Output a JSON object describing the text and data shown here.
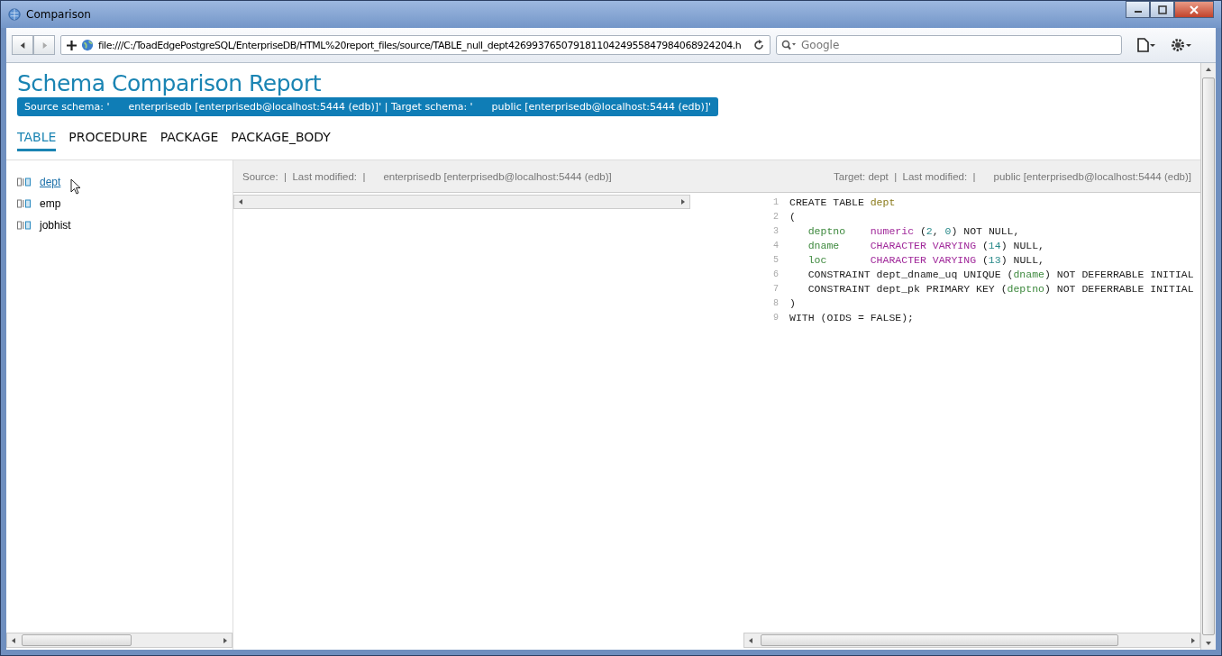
{
  "window": {
    "title": "Comparison"
  },
  "toolbar": {
    "url": "file:///C:/ToadEdgePostgreSQL/EnterpriseDB/HTML%20report_files/source/TABLE_null_dept42699376507918110424955847984068924204.h",
    "search_placeholder": "Google"
  },
  "report": {
    "title": "Schema Comparison Report",
    "banner": "Source schema: '      enterprisedb [enterprisedb@localhost:5444 (edb)]' | Target schema: '      public [enterprisedb@localhost:5444 (edb)]'"
  },
  "tabs": [
    {
      "label": "TABLE",
      "selected": true
    },
    {
      "label": "PROCEDURE",
      "selected": false
    },
    {
      "label": "PACKAGE",
      "selected": false
    },
    {
      "label": "PACKAGE_BODY",
      "selected": false
    }
  ],
  "objects": [
    {
      "name": "dept",
      "selected": true
    },
    {
      "name": "emp",
      "selected": false
    },
    {
      "name": "jobhist",
      "selected": false
    }
  ],
  "source_header": {
    "label": "Source:  |  Last modified:  |",
    "schema": "enterprisedb [enterprisedb@localhost:5444 (edb)]"
  },
  "target_header": {
    "label": "Target: dept  |  Last modified:  |",
    "schema": "public [enterprisedb@localhost:5444 (edb)]"
  },
  "target_code": [
    {
      "number": "1",
      "tokens": [
        {
          "text": "CREATE TABLE ",
          "kind": "plain"
        },
        {
          "text": "dept",
          "kind": "table"
        }
      ]
    },
    {
      "number": "2",
      "tokens": [
        {
          "text": "(",
          "kind": "plain"
        }
      ]
    },
    {
      "number": "3",
      "tokens": [
        {
          "text": "   deptno    ",
          "kind": "column"
        },
        {
          "text": "numeric",
          "kind": "type"
        },
        {
          "text": " (",
          "kind": "plain"
        },
        {
          "text": "2",
          "kind": "number"
        },
        {
          "text": ", ",
          "kind": "plain"
        },
        {
          "text": "0",
          "kind": "number"
        },
        {
          "text": ") NOT NULL,",
          "kind": "plain"
        }
      ]
    },
    {
      "number": "4",
      "tokens": [
        {
          "text": "   dname     ",
          "kind": "column"
        },
        {
          "text": "CHARACTER VARYING",
          "kind": "type"
        },
        {
          "text": " (",
          "kind": "plain"
        },
        {
          "text": "14",
          "kind": "number"
        },
        {
          "text": ") NULL,",
          "kind": "plain"
        }
      ]
    },
    {
      "number": "5",
      "tokens": [
        {
          "text": "   loc       ",
          "kind": "column"
        },
        {
          "text": "CHARACTER VARYING",
          "kind": "type"
        },
        {
          "text": " (",
          "kind": "plain"
        },
        {
          "text": "13",
          "kind": "number"
        },
        {
          "text": ") NULL,",
          "kind": "plain"
        }
      ]
    },
    {
      "number": "6",
      "tokens": [
        {
          "text": "   CONSTRAINT dept_dname_uq UNIQUE (",
          "kind": "plain"
        },
        {
          "text": "dname",
          "kind": "column"
        },
        {
          "text": ") NOT DEFERRABLE INITIAL",
          "kind": "plain"
        }
      ]
    },
    {
      "number": "7",
      "tokens": [
        {
          "text": "   CONSTRAINT dept_pk PRIMARY KEY (",
          "kind": "plain"
        },
        {
          "text": "deptno",
          "kind": "column"
        },
        {
          "text": ") NOT DEFERRABLE INITIAL",
          "kind": "plain"
        }
      ]
    },
    {
      "number": "8",
      "tokens": [
        {
          "text": ")",
          "kind": "plain"
        }
      ]
    },
    {
      "number": "9",
      "tokens": [
        {
          "text": "WITH (OIDS = FALSE);",
          "kind": "plain"
        }
      ]
    }
  ]
}
